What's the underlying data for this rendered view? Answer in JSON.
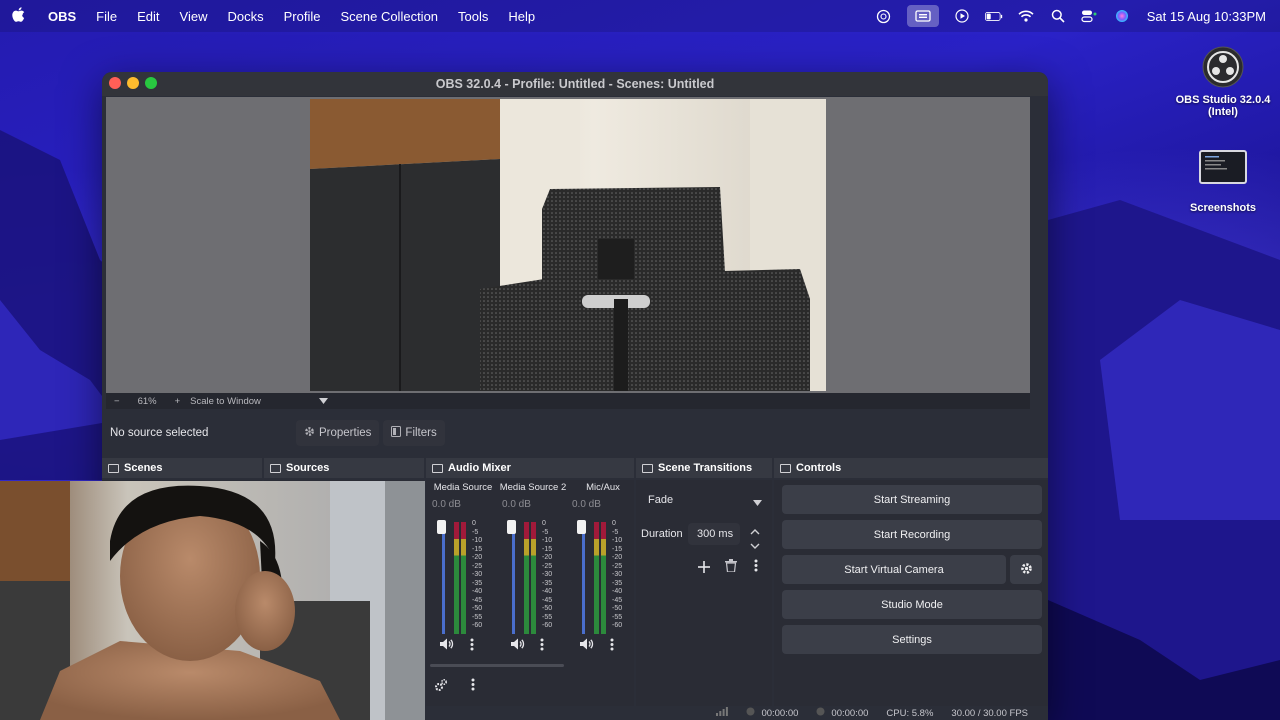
{
  "menubar": {
    "app_name": "OBS",
    "items": [
      "File",
      "Edit",
      "View",
      "Docks",
      "Profile",
      "Scene Collection",
      "Tools",
      "Help"
    ],
    "clock": "Sat 15 Aug  10:33PM",
    "status_icons": [
      "chatgpt-icon",
      "screen-mirroring-icon",
      "play-icon",
      "battery-icon",
      "wifi-icon",
      "search-icon",
      "control-center-icon",
      "siri-icon"
    ]
  },
  "desktop": {
    "obs_label": "OBS Studio 32.0.4 (Intel)",
    "screenshots_label": "Screenshots"
  },
  "window": {
    "title": "OBS 32.0.4 - Profile: Untitled - Scenes: Untitled",
    "zoom": {
      "minus": "−",
      "percent": "61%",
      "plus": "+",
      "scale_mode": "Scale to Window"
    },
    "source_bar": {
      "status": "No source selected",
      "properties": "Properties",
      "filters": "Filters"
    },
    "docks": {
      "scenes": "Scenes",
      "sources": "Sources",
      "audio_mixer": "Audio Mixer",
      "scene_transitions": "Scene Transitions",
      "controls": "Controls"
    },
    "mixer": {
      "channels": [
        {
          "name": "Media Source",
          "db": "0.0 dB"
        },
        {
          "name": "Media Source 2",
          "db": "0.0 dB"
        },
        {
          "name": "Mic/Aux",
          "db": "0.0 dB"
        }
      ],
      "scale": [
        "0",
        "-5",
        "-10",
        "-15",
        "-20",
        "-25",
        "-30",
        "-35",
        "-40",
        "-45",
        "-50",
        "-55",
        "-60"
      ]
    },
    "transitions": {
      "selected": "Fade",
      "duration_label": "Duration",
      "duration_value": "300 ms"
    },
    "controls": {
      "start_streaming": "Start Streaming",
      "start_recording": "Start Recording",
      "start_virtual_camera": "Start Virtual Camera",
      "studio_mode": "Studio Mode",
      "settings": "Settings"
    },
    "status": {
      "stream_time": "00:00:00",
      "record_time": "00:00:00",
      "cpu": "CPU: 5.8%",
      "fps": "30.00 / 30.00 FPS"
    }
  },
  "colors": {
    "accent": "#4a6ecc",
    "close": "#ff5f57",
    "minimize": "#febc2e",
    "zoom": "#28c840"
  }
}
